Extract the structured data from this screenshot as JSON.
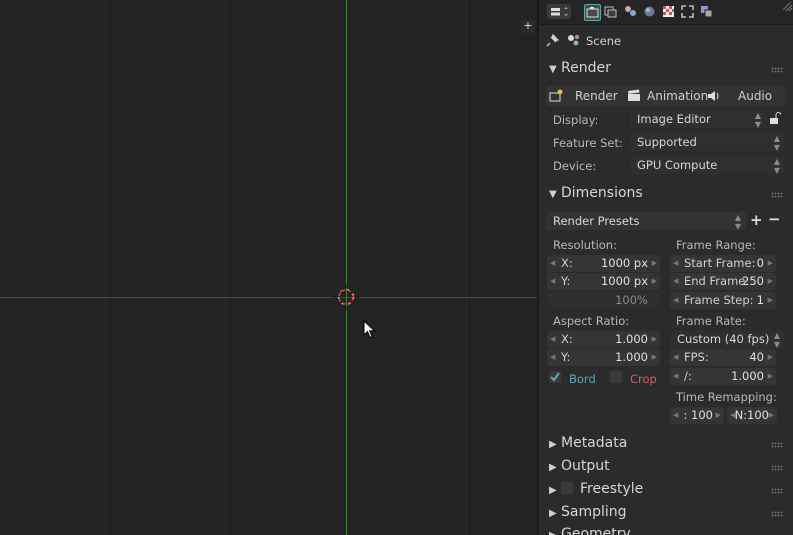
{
  "viewport": {
    "add_button": "+"
  },
  "panel": {
    "context": {
      "scene_label": "Scene"
    },
    "render_section": {
      "title": "Render",
      "buttons": {
        "render": "Render",
        "animation": "Animation",
        "audio": "Audio"
      },
      "display_label": "Display:",
      "display_value": "Image Editor",
      "feature_set_label": "Feature Set:",
      "feature_set_value": "Supported",
      "device_label": "Device:",
      "device_value": "GPU Compute"
    },
    "dimensions_section": {
      "title": "Dimensions",
      "presets": "Render Presets",
      "resolution_label": "Resolution:",
      "res_x_label": "X:",
      "res_x_value": "1000 px",
      "res_y_label": "Y:",
      "res_y_value": "1000 px",
      "res_percent": "100%",
      "frame_range_label": "Frame Range:",
      "start_frame_label": "Start Frame:",
      "start_frame_value": "0",
      "end_frame_label": "End Frame:",
      "end_frame_value": "250",
      "frame_step_label": "Frame Step:",
      "frame_step_value": "1",
      "aspect_label": "Aspect Ratio:",
      "aspect_x_label": "X:",
      "aspect_x_value": "1.000",
      "aspect_y_label": "Y:",
      "aspect_y_value": "1.000",
      "frame_rate_label": "Frame Rate:",
      "frame_rate_value": "Custom (40 fps)",
      "fps_label": "FPS:",
      "fps_value": "40",
      "base_label": "/:",
      "base_value": "1.000",
      "border_label": "Bord",
      "border_checked": true,
      "crop_label": "Crop",
      "crop_checked": false,
      "time_remap_label": "Time Remapping:",
      "remap_old": ": 100",
      "remap_new": "N:100"
    },
    "collapsed_sections": [
      "Metadata",
      "Output",
      "Freestyle",
      "Sampling",
      "Geometry"
    ],
    "colors": {
      "accent_check": "#5fa8b8",
      "crop_red": "#d06060",
      "axis_x": "#7a3636",
      "axis_y": "#3f8a3f"
    }
  }
}
